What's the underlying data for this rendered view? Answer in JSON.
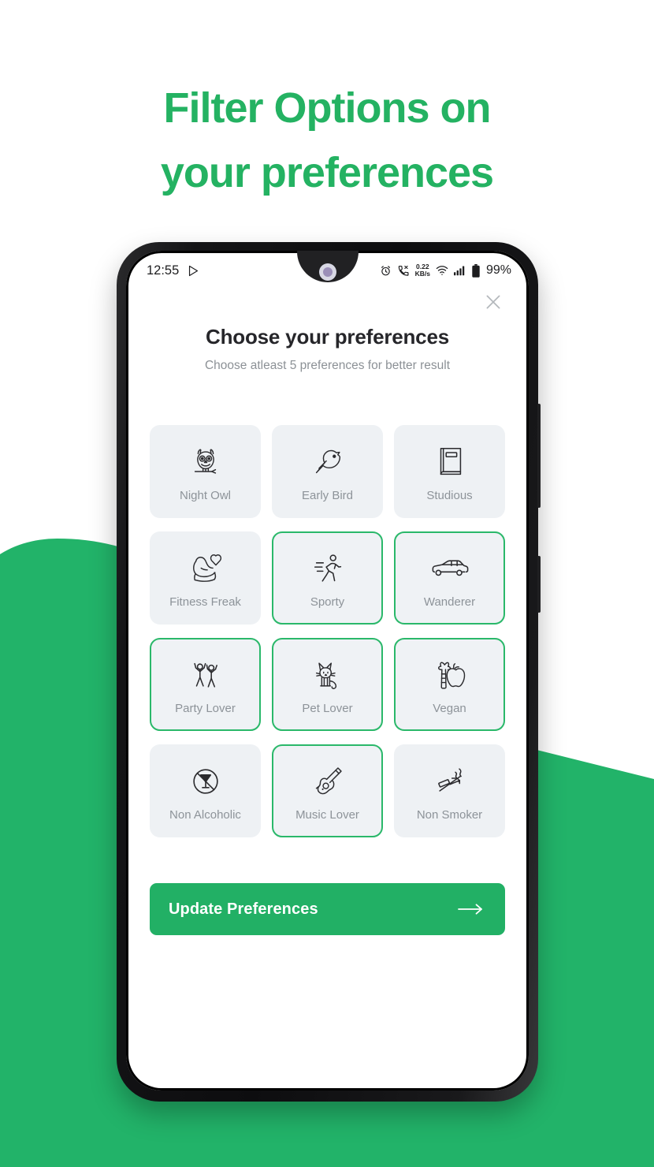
{
  "headline": {
    "line1": "Filter Options on",
    "line2": "your preferences",
    "color": "#24b262"
  },
  "theme": {
    "background_green": "#22b369",
    "button_green": "#22b065",
    "selected_border": "#2ab86a",
    "card_background": "#eef1f4",
    "label_gray": "#8d9399"
  },
  "statusbar": {
    "time": "12:55",
    "playstore_icon": "play-triangle-icon",
    "alarm_icon": "alarm-clock-icon",
    "call_icon": "phone-missed-icon",
    "network_speed_value": "0.22",
    "network_speed_unit": "KB/s",
    "wifi_icon": "wifi-icon",
    "signal_icon": "cellular-signal-icon",
    "battery_icon": "battery-full-icon",
    "battery_percent": "99%"
  },
  "sheet": {
    "close_icon": "close-x-icon",
    "title": "Choose your preferences",
    "subtitle": "Choose atleast 5 preferences for better result"
  },
  "preferences": [
    {
      "label": "Night Owl",
      "icon": "owl-icon",
      "selected": false
    },
    {
      "label": "Early Bird",
      "icon": "bird-icon",
      "selected": false
    },
    {
      "label": "Studious",
      "icon": "book-icon",
      "selected": false
    },
    {
      "label": "Fitness Freak",
      "icon": "bicep-heart-icon",
      "selected": false
    },
    {
      "label": "Sporty",
      "icon": "runner-icon",
      "selected": true
    },
    {
      "label": "Wanderer",
      "icon": "car-icon",
      "selected": true
    },
    {
      "label": "Party Lover",
      "icon": "dancers-icon",
      "selected": true
    },
    {
      "label": "Pet Lover",
      "icon": "cat-icon",
      "selected": true
    },
    {
      "label": "Vegan",
      "icon": "carrot-apple-icon",
      "selected": true
    },
    {
      "label": "Non Alcoholic",
      "icon": "no-alcohol-icon",
      "selected": false
    },
    {
      "label": "Music Lover",
      "icon": "guitar-icon",
      "selected": true
    },
    {
      "label": "Non Smoker",
      "icon": "no-smoking-icon",
      "selected": false
    }
  ],
  "cta": {
    "label": "Update Preferences",
    "arrow_icon": "arrow-right-icon"
  }
}
